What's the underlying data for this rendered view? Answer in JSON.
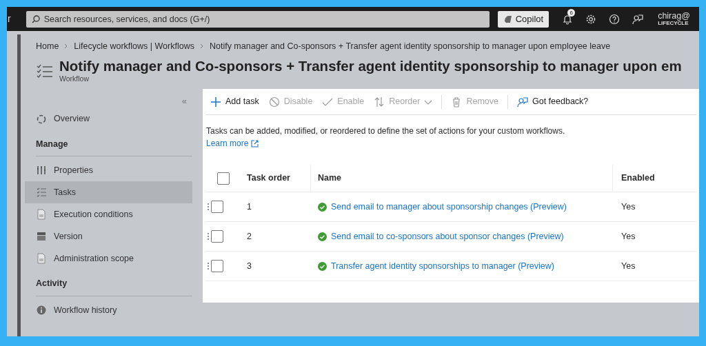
{
  "topbar": {
    "brand_fragment": "r",
    "search": {
      "placeholder": "Search resources, services, and docs (G+/)"
    },
    "copilot": "Copilot",
    "notifications_badge": "6",
    "user": {
      "name": "chirag@",
      "tenant": "LIFECYCLE"
    }
  },
  "breadcrumb": [
    "Home",
    "Lifecycle workflows | Workflows",
    "Notify manager and Co-sponsors + Transfer agent identity sponsorship to manager upon employee leave"
  ],
  "page": {
    "title": "Notify manager and Co-sponsors + Transfer agent identity sponsorship to manager upon em",
    "subtitle": "Workflow"
  },
  "sidebar": {
    "collapse": "«",
    "items": [
      {
        "kind": "item",
        "label": "Overview",
        "selected": false
      },
      {
        "kind": "heading",
        "label": "Manage"
      },
      {
        "kind": "item",
        "label": "Properties",
        "selected": false
      },
      {
        "kind": "item",
        "label": "Tasks",
        "selected": true
      },
      {
        "kind": "item",
        "label": "Execution conditions",
        "selected": false
      },
      {
        "kind": "item",
        "label": "Version",
        "selected": false
      },
      {
        "kind": "item",
        "label": "Administration scope",
        "selected": false
      },
      {
        "kind": "heading",
        "label": "Activity"
      },
      {
        "kind": "item",
        "label": "Workflow history",
        "selected": false
      }
    ]
  },
  "toolbar": [
    {
      "kind": "button",
      "label": "Add task",
      "disabled": false
    },
    {
      "kind": "button",
      "label": "Disable",
      "disabled": true
    },
    {
      "kind": "button",
      "label": "Enable",
      "disabled": true
    },
    {
      "kind": "dropdown",
      "label": "Reorder",
      "disabled": true
    },
    {
      "kind": "separator"
    },
    {
      "kind": "button",
      "label": "Remove",
      "disabled": true
    },
    {
      "kind": "separator"
    },
    {
      "kind": "button",
      "label": "Got feedback?",
      "disabled": false
    }
  ],
  "description": "Tasks can be added, modified, or reordered to define the set of actions for your custom workflows.",
  "learn_more": "Learn more",
  "table": {
    "header_checked": false,
    "columns": [
      "Task order",
      "Name",
      "Enabled"
    ],
    "rows": [
      {
        "checked": false,
        "order": "1",
        "name": "Send email to manager about sponsorship changes (Preview)",
        "enabled": "Yes"
      },
      {
        "checked": false,
        "order": "2",
        "name": "Send email to co-sponsors about sponsor changes (Preview)",
        "enabled": "Yes"
      },
      {
        "checked": false,
        "order": "3",
        "name": "Transfer agent identity sponsorships to manager (Preview)",
        "enabled": "Yes"
      }
    ]
  }
}
